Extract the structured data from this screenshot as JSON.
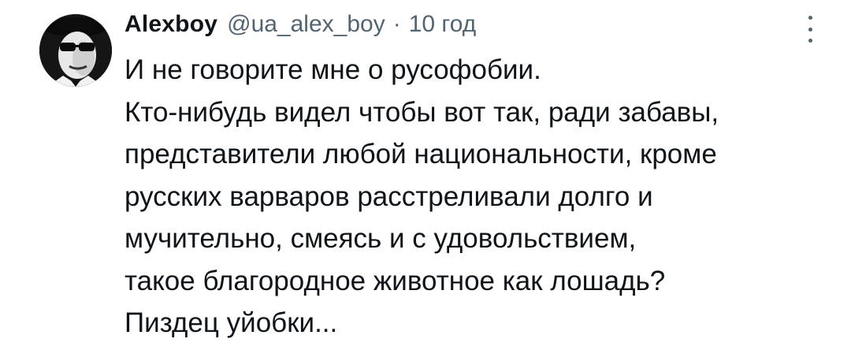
{
  "tweet": {
    "author": {
      "name": "Alexboy",
      "handle": "@ua_alex_boy",
      "avatar": "avatar-photo"
    },
    "separator": "·",
    "time": "10 год",
    "more_icon": "more-vertical-icon",
    "lines": [
      "И не говорите мне о русофобии.",
      "Кто-нибудь видел чтобы вот так, ради забавы,",
      "представители любой национальности, кроме",
      "русских варваров расстреливали долго и",
      "мучительно, смеясь и с удовольствием,",
      "такое благородное животное как лошадь?",
      "Пиздец уйобки..."
    ]
  }
}
